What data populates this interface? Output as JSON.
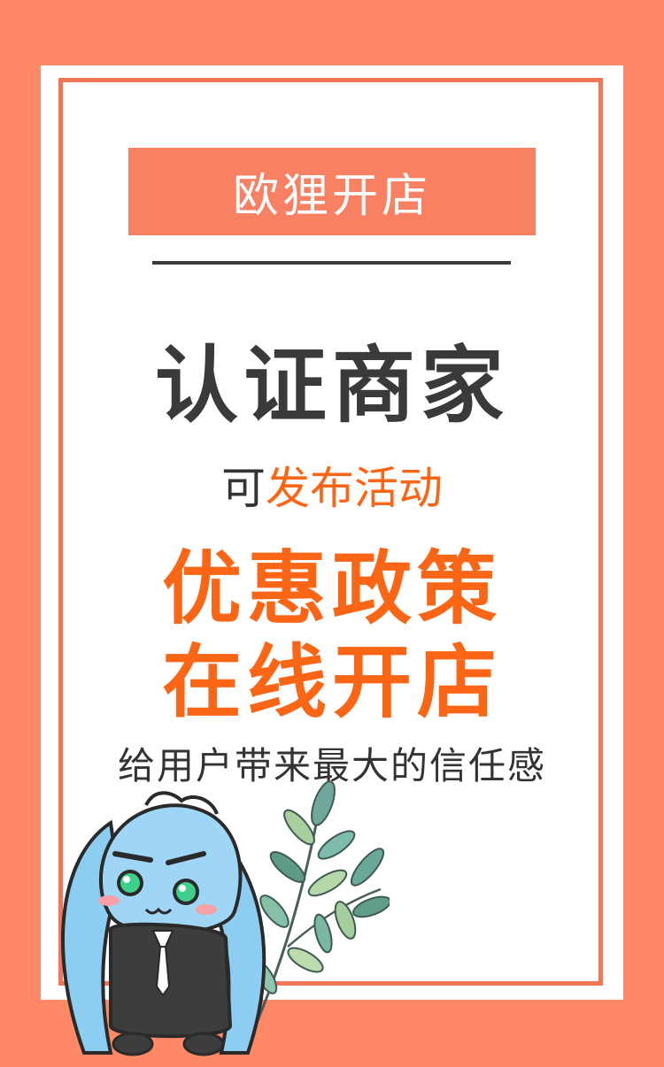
{
  "poster": {
    "title_badge": "欧狸开店",
    "headline": "认证商家",
    "subline_prefix": "可",
    "subline_highlight": "发布活动",
    "line_policy": "优惠政策",
    "line_online": "在线开店",
    "tagline": "给用户带来最大的信任感"
  },
  "colors": {
    "background": "#ff8866",
    "frame": "#f37657",
    "badge": "#f98163",
    "highlight": "#fa6616",
    "text_dark": "#3a3a3a"
  },
  "illustrations": [
    "leaf-branch",
    "mascot-character"
  ]
}
